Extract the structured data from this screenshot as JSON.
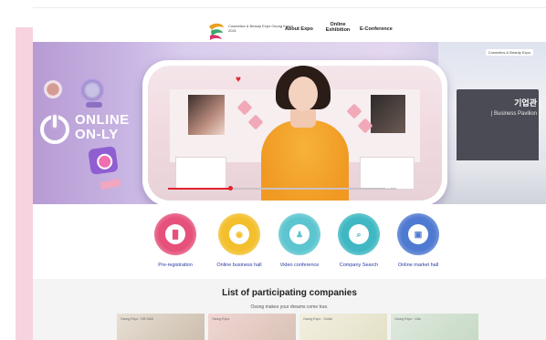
{
  "header": {
    "logo_text": "Cosmetics & Beauty Expo Osong Korea 2021",
    "nav": [
      "About Expo",
      "Online Exhibition",
      "E-Conference"
    ]
  },
  "hero": {
    "headline_line1": "ONLINE",
    "headline_line2": "ON-LY",
    "right_sign": "Cosmetics & Beauty Expo",
    "right_pavilion_title": "기업관",
    "right_pavilion_sub": "| Business Pavilion",
    "player_controls": "▮▮ ▶▶ ◀▶",
    "slide_count": 3,
    "slide_active": 1,
    "video_progress": 0.27
  },
  "quick_menu": [
    {
      "label": "Pre-registration",
      "icon": "bar-chart-icon",
      "glyph": "▐▌",
      "color": "#e5517a"
    },
    {
      "label": "Online business hall",
      "icon": "globe-icon",
      "glyph": "◉",
      "color": "#f3bf2c"
    },
    {
      "label": "Video conference",
      "icon": "user-icon",
      "glyph": "♟",
      "color": "#5cc5cf"
    },
    {
      "label": "Company Search",
      "icon": "search-icon",
      "glyph": "⌕",
      "color": "#3fb8c3"
    },
    {
      "label": "Online market hall",
      "icon": "save-icon",
      "glyph": "▣",
      "color": "#4f7ad1"
    }
  ],
  "companies": {
    "title": "List of participating companies",
    "subtitle": "Osong makes your dreams come true.",
    "cards": [
      {
        "logo": "Osong Expo · DR.SAM",
        "bg": "linear-gradient(135deg,#e7ded3,#cdbfae)"
      },
      {
        "logo": "Osong Expo",
        "bg": "linear-gradient(135deg,#f1d6d3,#d9c2b6)"
      },
      {
        "logo": "Osong Expo · Ondal",
        "bg": "linear-gradient(135deg,#f3efe0,#e3e1c8)"
      },
      {
        "logo": "Osong Expo · Lilia",
        "bg": "linear-gradient(135deg,#dfe9dd,#c7dac7)"
      }
    ]
  },
  "colors": {
    "accent_blue": "#2b3a9f",
    "pink_strip": "#f7d2df",
    "progress_red": "#e0242e"
  }
}
